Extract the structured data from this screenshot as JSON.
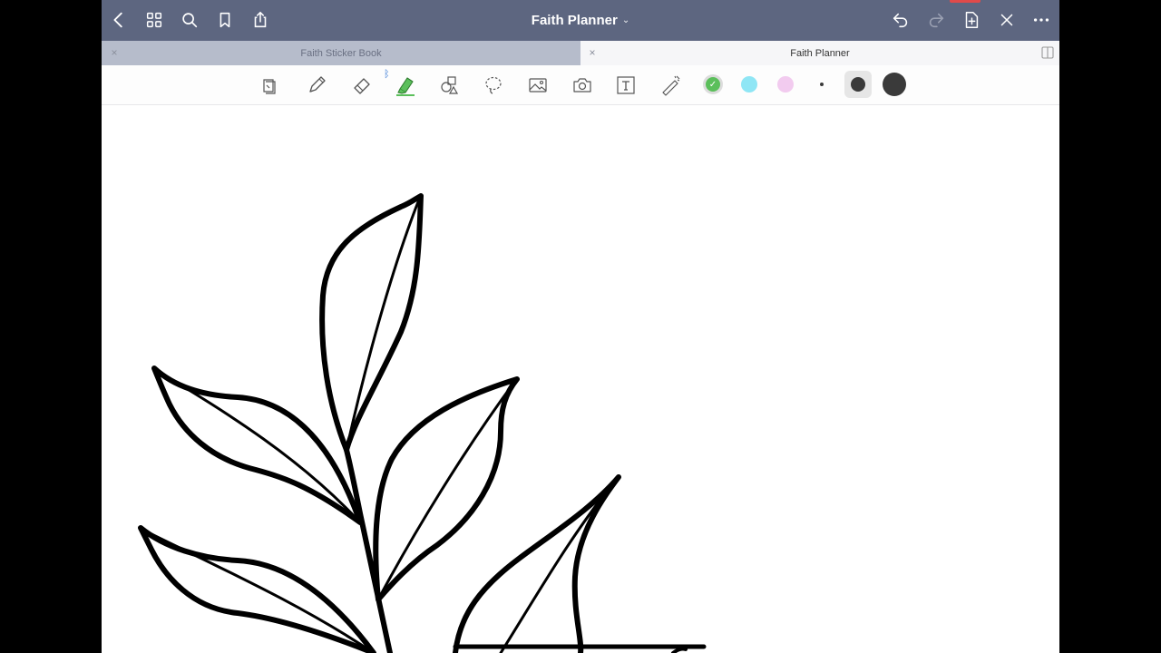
{
  "app": {
    "title": "Faith Planner",
    "title_chevron": "⌄"
  },
  "nav": {
    "left": [
      "back-icon",
      "grid-icon",
      "search-icon",
      "bookmark-icon",
      "share-icon"
    ],
    "right": [
      "undo-icon",
      "redo-icon",
      "add-page-icon",
      "close-icon",
      "more-icon"
    ]
  },
  "tabs": [
    {
      "label": "Faith Sticker Book",
      "active": false,
      "close": "×"
    },
    {
      "label": "Faith Planner",
      "active": true,
      "close": "×"
    }
  ],
  "toolbar": {
    "tools": [
      "read-mode-icon",
      "pen-icon",
      "eraser-icon",
      "highlighter-icon",
      "shapes-icon",
      "lasso-icon",
      "image-icon",
      "camera-icon",
      "text-icon",
      "laser-pointer-icon"
    ],
    "bluetooth_indicator": "ᛒ",
    "highlighter_color": "#5bbf5b",
    "colors": [
      "#5bbf5b",
      "#8fe6f5",
      "#f2cbef"
    ],
    "selected_color_check": "✓",
    "stroke_sizes": [
      "small",
      "medium",
      "large"
    ],
    "stroke_color": "#3a3a3a"
  },
  "colors": {
    "nav_bg": "#5d6680",
    "tab_inactive_bg": "#b6bccb",
    "ink": "#000000"
  }
}
